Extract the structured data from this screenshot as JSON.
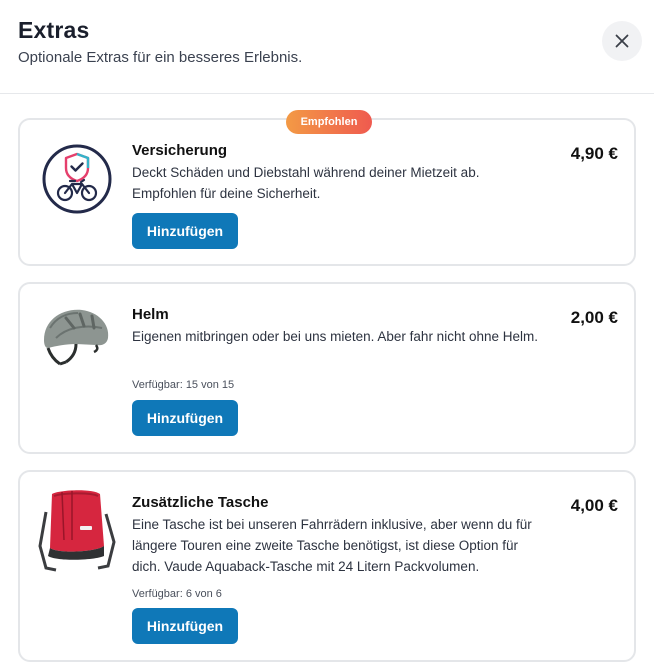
{
  "header": {
    "title": "Extras",
    "subtitle": "Optionale Extras für ein besseres Erlebnis.",
    "close_icon": "close-icon"
  },
  "extras": [
    {
      "badge": "Empfohlen",
      "name": "Versicherung",
      "description": "Deckt Schäden und Diebstahl während deiner Mietzeit ab. Empfohlen für deine Sicherheit.",
      "availability": "",
      "price": "4,90 €",
      "button_label": "Hinzufügen",
      "icon": "insurance-bike-icon"
    },
    {
      "badge": "",
      "name": "Helm",
      "description": "Eigenen mitbringen oder bei uns mieten. Aber fahr nicht ohne Helm.",
      "availability": "Verfügbar: 15 von 15",
      "price": "2,00 €",
      "button_label": "Hinzufügen",
      "icon": "helmet-image"
    },
    {
      "badge": "",
      "name": "Zusätzliche Tasche",
      "description": "Eine Tasche ist bei unseren Fahrrädern inklusive, aber wenn du für längere Touren eine zweite Tasche benötigst, ist diese Option für dich. Vaude Aquaback-Tasche mit 24 Litern Packvolumen.",
      "availability": "Verfügbar: 6 von 6",
      "price": "4,00 €",
      "button_label": "Hinzufügen",
      "icon": "pannier-bag-image"
    }
  ],
  "colors": {
    "primary_button": "#0f78b8",
    "badge_start": "#f39a45",
    "badge_end": "#ef5a4f"
  }
}
